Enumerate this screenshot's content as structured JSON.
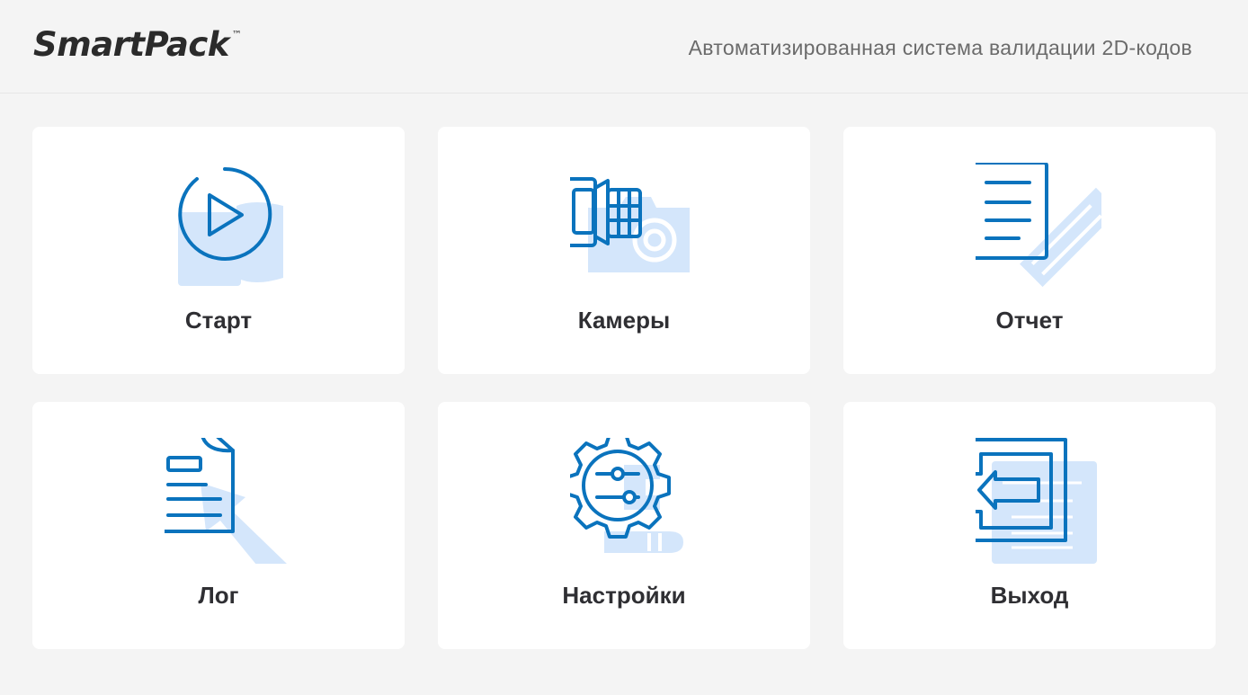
{
  "header": {
    "logo": "SmartPack",
    "logo_tm": "™",
    "subtitle": "Автоматизированная система валидации 2D-кодов"
  },
  "tiles": [
    {
      "label": "Старт",
      "icon": "play-icon"
    },
    {
      "label": "Камеры",
      "icon": "camera-icon"
    },
    {
      "label": "Отчет",
      "icon": "report-icon"
    },
    {
      "label": "Лог",
      "icon": "log-icon"
    },
    {
      "label": "Настройки",
      "icon": "settings-gear-icon"
    },
    {
      "label": "Выход",
      "icon": "exit-icon"
    }
  ],
  "colors": {
    "background": "#f4f4f4",
    "tile": "#ffffff",
    "icon_line": "#0a73bd",
    "icon_fill": "#d4e6fb",
    "label_text": "#2f2f33",
    "subtitle_text": "#6b6b6b"
  }
}
